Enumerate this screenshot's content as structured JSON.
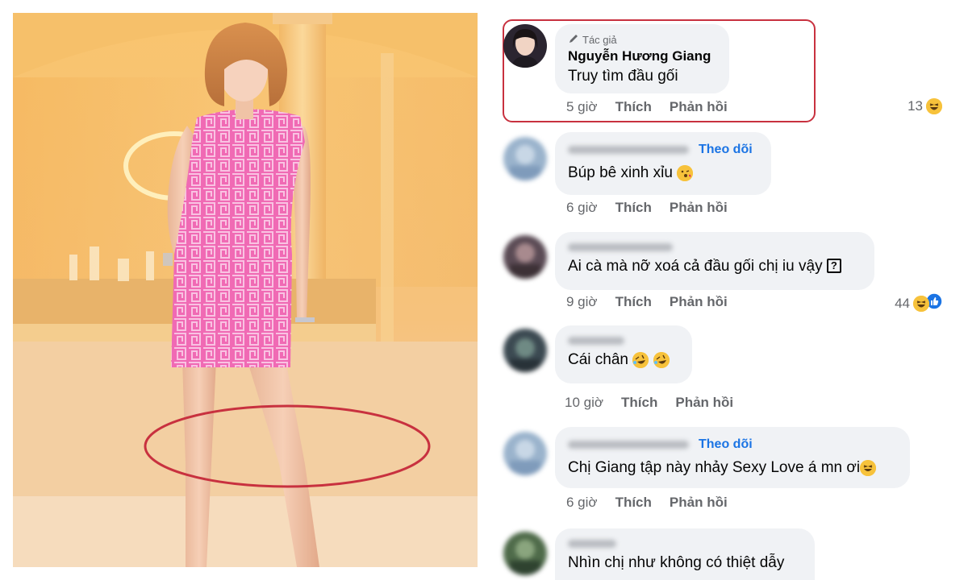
{
  "comments": [
    {
      "author_tag": "Tác giả",
      "author_name": "Nguyễn Hương Giang",
      "text": "Truy tìm đầu gối",
      "time": "5 giờ",
      "like": "Thích",
      "reply": "Phản hồi",
      "reaction_count": "13",
      "reaction_icons": [
        "haha-emoji"
      ],
      "highlighted": true
    },
    {
      "follow": "Theo dõi",
      "text": "Búp bê xinh xỉu",
      "text_emoji": "kiss-emoji",
      "time": "6 giờ",
      "like": "Thích",
      "reply": "Phản hồi"
    },
    {
      "text": "Ai cà mà nỡ xoá cả đầu gối chị iu vậy",
      "text_symbol": "?",
      "time": "9 giờ",
      "like": "Thích",
      "reply": "Phản hồi",
      "reaction_count": "44",
      "reaction_icons": [
        "haha-emoji",
        "like-icon"
      ]
    },
    {
      "text": "Cái chân",
      "text_emoji": "rofl-emoji",
      "time": "10 giờ",
      "like": "Thích",
      "reply": "Phản hồi"
    },
    {
      "follow": "Theo dõi",
      "text": "Chị Giang tập này nhảy Sexy Love á mn ơi",
      "text_emoji": "laughing-emoji",
      "time": "6 giờ",
      "like": "Thích",
      "reply": "Phản hồi"
    },
    {
      "text": "Nhìn chị như không có thiệt dẫy"
    }
  ],
  "colors": {
    "highlight_border": "#c8313f",
    "photo_circle": "#c8313f",
    "follow_link": "#1b74e4",
    "bubble": "#f0f2f5",
    "dress_pink": "#f06ab4"
  }
}
